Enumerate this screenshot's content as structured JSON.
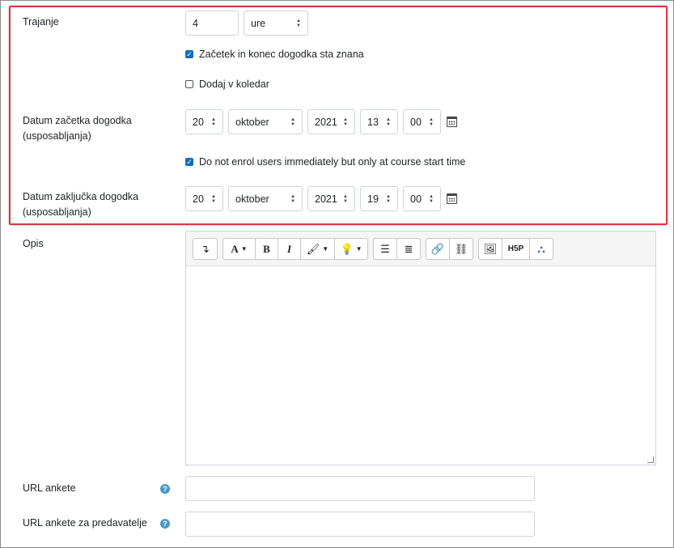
{
  "duration": {
    "label": "Trajanje",
    "value": "4",
    "unit": "ure"
  },
  "checks": {
    "known_start_end": {
      "label": "Začetek in konec dogodka sta znana",
      "checked": true
    },
    "add_to_calendar": {
      "label": "Dodaj v koledar",
      "checked": false
    },
    "no_enrol": {
      "label": "Do not enrol users immediately but only at course start time",
      "checked": true
    }
  },
  "start": {
    "label_line1": "Datum začetka dogodka",
    "label_line2": "(usposabljanja)",
    "day": "20",
    "month": "oktober",
    "year": "2021",
    "hour": "13",
    "minute": "00"
  },
  "end": {
    "label_line1": "Datum zaključka dogodka",
    "label_line2": "(usposabljanja)",
    "day": "20",
    "month": "oktober",
    "year": "2021",
    "hour": "19",
    "minute": "00"
  },
  "description": {
    "label": "Opis",
    "toolbar_icons": [
      "collapse-icon",
      "font-color-icon",
      "bold-icon",
      "italic-icon",
      "style-brush-icon",
      "idea-icon",
      "unordered-list-icon",
      "ordered-list-icon",
      "link-icon",
      "unlink-icon",
      "image-icon",
      "h5p-icon",
      "teams-icon"
    ],
    "bold_glyph": "B",
    "italic_glyph": "I",
    "font_glyph": "A",
    "h5p_glyph": "H5P"
  },
  "survey_url": {
    "label": "URL ankete",
    "value": ""
  },
  "survey_url_lecturers": {
    "label": "URL ankete za predavatelje",
    "value": ""
  },
  "help_glyph": "?",
  "colors": {
    "highlight": "#d9363e",
    "checkbox": "#0f6cbf",
    "help": "#4a98c9"
  }
}
